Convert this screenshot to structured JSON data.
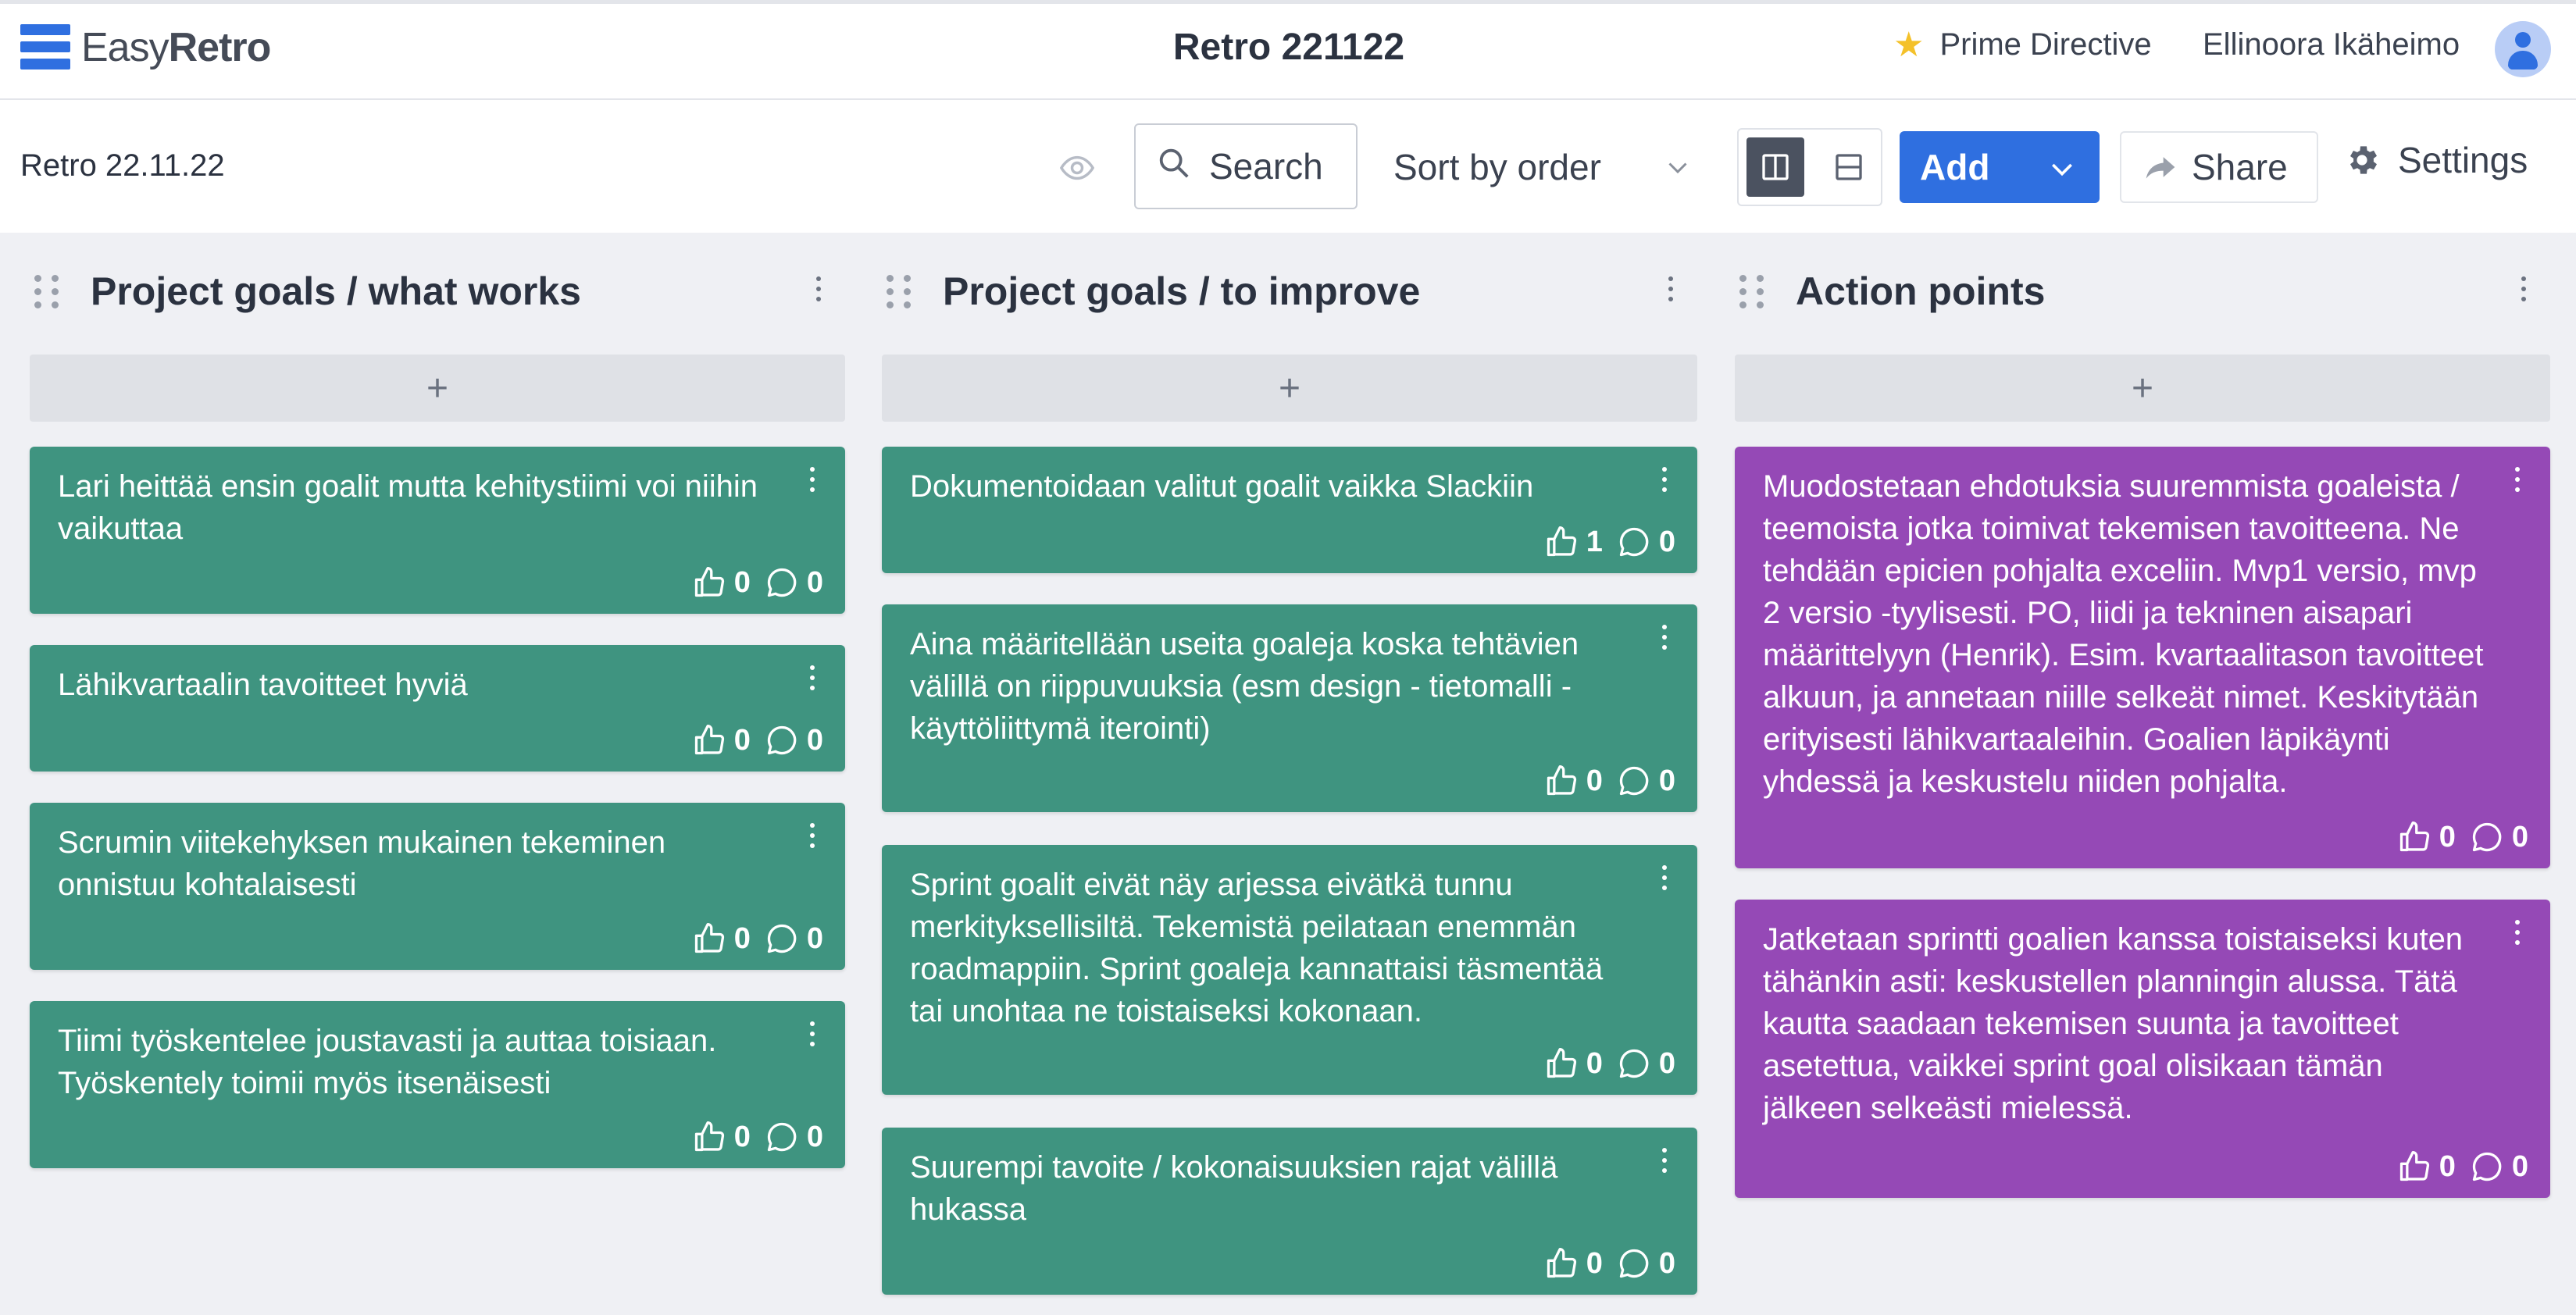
{
  "header": {
    "logo_easy": "Easy",
    "logo_retro": "Retro",
    "board_title": "Retro 221122",
    "prime_directive": "Prime Directive",
    "user_name": "Ellinoora Ikäheimo"
  },
  "toolbar": {
    "board_name": "Retro 22.11.22",
    "search_label": "Search",
    "sort_label": "Sort by order",
    "add_label": "Add",
    "share_label": "Share",
    "settings_label": "Settings"
  },
  "colors": {
    "brand": "#2f6fe0",
    "card_green": "#3f9480",
    "card_purple": "#9549b6",
    "star": "#f4c12a"
  },
  "columns": [
    {
      "title": "Project goals / what works",
      "add_symbol": "+",
      "cards": [
        {
          "text": "Lari heittää ensin goalit mutta kehitystiimi voi niihin vaikuttaa",
          "votes": "0",
          "comments": "0"
        },
        {
          "text": "Lähikvartaalin tavoitteet hyviä",
          "votes": "0",
          "comments": "0"
        },
        {
          "text": "Scrumin viitekehyksen mukainen tekeminen onnistuu kohtalaisesti",
          "votes": "0",
          "comments": "0"
        },
        {
          "text": "Tiimi työskentelee joustavasti ja auttaa toisiaan. Työskentely toimii myös itsenäisesti",
          "votes": "0",
          "comments": "0"
        }
      ]
    },
    {
      "title": "Project goals / to improve",
      "add_symbol": "+",
      "cards": [
        {
          "text": "Dokumentoidaan valitut goalit vaikka Slackiin",
          "votes": "1",
          "comments": "0"
        },
        {
          "text": "Aina määritellään useita goaleja koska tehtävien välillä on riippuvuuksia (esm design - tietomalli - käyttöliittymä iterointi)",
          "votes": "0",
          "comments": "0"
        },
        {
          "text": "Sprint goalit eivät näy arjessa eivätkä tunnu merkityksellisiltä. Tekemistä peilataan enemmän roadmappiin. Sprint goaleja kannattaisi täsmentää tai unohtaa ne toistaiseksi kokonaan.",
          "votes": "0",
          "comments": "0"
        },
        {
          "text": "Suurempi tavoite / kokonaisuuksien rajat välillä hukassa",
          "votes": "0",
          "comments": "0"
        }
      ]
    },
    {
      "title": "Action points",
      "add_symbol": "+",
      "cards": [
        {
          "text": "Muodostetaan ehdotuksia suuremmista goaleista / teemoista jotka toimivat tekemisen tavoitteena. Ne tehdään epicien pohjalta exceliin. Mvp1 versio, mvp 2 versio -tyylisesti. PO, liidi ja tekninen aisapari määrittelyyn (Henrik). Esim. kvartaalitason tavoitteet alkuun, ja annetaan niille selkeät nimet. Keskitytään erityisesti lähikvartaaleihin. Goalien läpikäynti yhdessä ja keskustelu niiden pohjalta.",
          "votes": "0",
          "comments": "0"
        },
        {
          "text": "Jatketaan sprintti goalien kanssa toistaiseksi kuten tähänkin asti: keskustellen planningin alussa. Tätä kautta saadaan tekemisen suunta ja tavoitteet asetettua, vaikkei sprint goal olisikaan tämän jälkeen selkeästi mielessä.",
          "votes": "0",
          "comments": "0"
        }
      ]
    }
  ]
}
